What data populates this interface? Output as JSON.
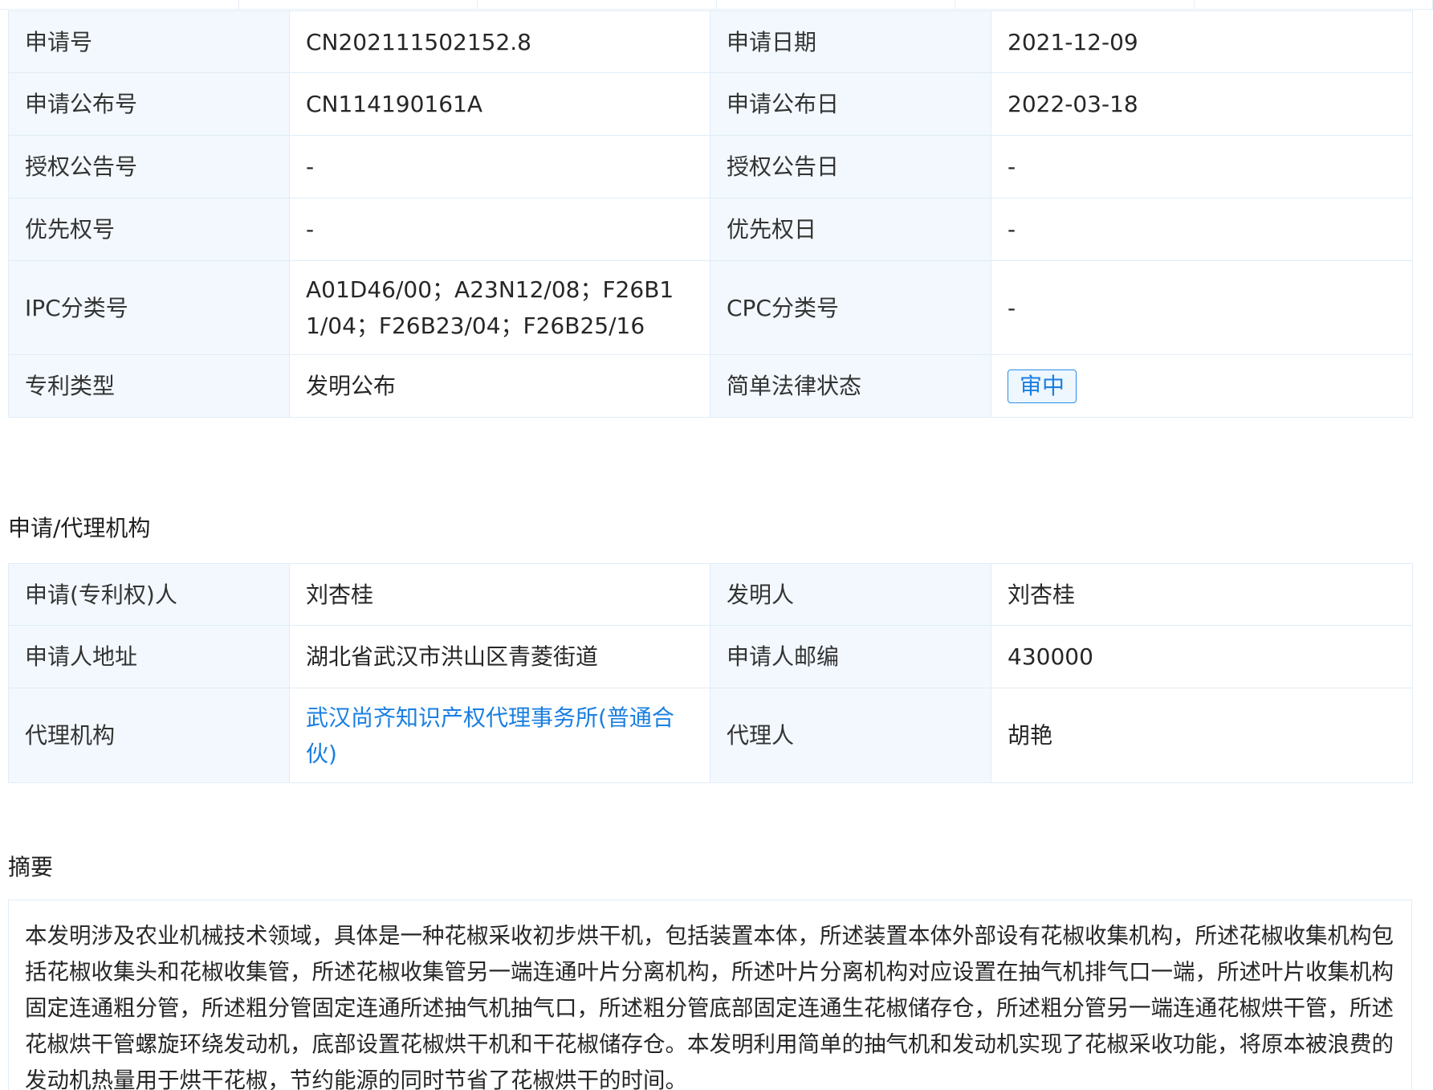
{
  "basic": {
    "app_no_label": "申请号",
    "app_no": "CN202111502152.8",
    "app_date_label": "申请日期",
    "app_date": "2021-12-09",
    "pub_no_label": "申请公布号",
    "pub_no": "CN114190161A",
    "pub_date_label": "申请公布日",
    "pub_date": "2022-03-18",
    "grant_no_label": "授权公告号",
    "grant_no": "-",
    "grant_date_label": "授权公告日",
    "grant_date": "-",
    "priority_no_label": "优先权号",
    "priority_no": "-",
    "priority_date_label": "优先权日",
    "priority_date": "-",
    "ipc_label": "IPC分类号",
    "ipc": "A01D46/00；A23N12/08；F26B11/04；F26B23/04；F26B25/16",
    "cpc_label": "CPC分类号",
    "cpc": "-",
    "type_label": "专利类型",
    "type": "发明公布",
    "legal_status_label": "简单法律状态",
    "legal_status": "审中"
  },
  "agent_section": {
    "title": "申请/代理机构",
    "applicant_label": "申请(专利权)人",
    "applicant": "刘杏桂",
    "inventor_label": "发明人",
    "inventor": "刘杏桂",
    "address_label": "申请人地址",
    "address": "湖北省武汉市洪山区青菱街道",
    "zip_label": "申请人邮编",
    "zip": "430000",
    "agency_label": "代理机构",
    "agency": "武汉尚齐知识产权代理事务所(普通合伙)",
    "agent_label": "代理人",
    "agent": "胡艳"
  },
  "abstract_section": {
    "title": "摘要",
    "text": "本发明涉及农业机械技术领域，具体是一种花椒采收初步烘干机，包括装置本体，所述装置本体外部设有花椒收集机构，所述花椒收集机构包括花椒收集头和花椒收集管，所述花椒收集管另一端连通叶片分离机构，所述叶片分离机构对应设置在抽气机排气口一端，所述叶片收集机构固定连通粗分管，所述粗分管固定连通所述抽气机抽气口，所述粗分管底部固定连通生花椒储存仓，所述粗分管另一端连通花椒烘干管，所述花椒烘干管螺旋环绕发动机，底部设置花椒烘干机和干花椒储存仓。本发明利用简单的抽气机和发动机实现了花椒采收功能，将原本被浪费的发动机热量用于烘干花椒，节约能源的同时节省了花椒烘干的时间。"
  },
  "colors": {
    "label_bg": "#f2f8fd",
    "border": "#e1ecf7",
    "link": "#1a7fe0"
  }
}
